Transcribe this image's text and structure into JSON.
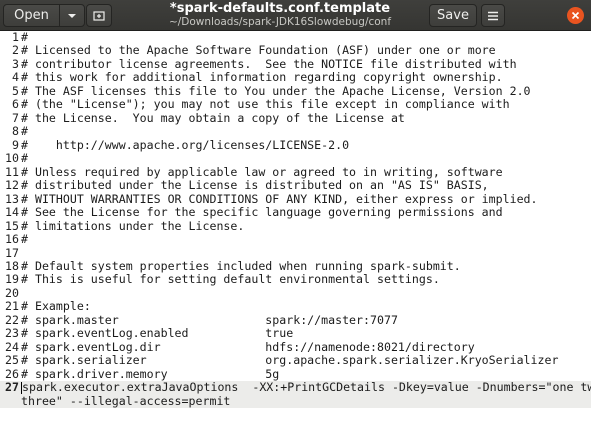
{
  "header": {
    "open_label": "Open",
    "save_label": "Save",
    "title": "*spark-defaults.conf.template",
    "subtitle": "~/Downloads/spark-JDK16Slowdebug/conf",
    "icons": [
      "chevron-down-icon",
      "new-tab-icon",
      "hamburger-menu-icon",
      "close-icon"
    ]
  },
  "editor": {
    "lines": [
      {
        "n": "1",
        "text": "#"
      },
      {
        "n": "2",
        "text": "# Licensed to the Apache Software Foundation (ASF) under one or more"
      },
      {
        "n": "3",
        "text": "# contributor license agreements.  See the NOTICE file distributed with"
      },
      {
        "n": "4",
        "text": "# this work for additional information regarding copyright ownership."
      },
      {
        "n": "5",
        "text": "# The ASF licenses this file to You under the Apache License, Version 2.0"
      },
      {
        "n": "6",
        "text": "# (the \"License\"); you may not use this file except in compliance with"
      },
      {
        "n": "7",
        "text": "# the License.  You may obtain a copy of the License at"
      },
      {
        "n": "8",
        "text": "#"
      },
      {
        "n": "9",
        "text": "#    http://www.apache.org/licenses/LICENSE-2.0"
      },
      {
        "n": "10",
        "text": "#"
      },
      {
        "n": "11",
        "text": "# Unless required by applicable law or agreed to in writing, software"
      },
      {
        "n": "12",
        "text": "# distributed under the License is distributed on an \"AS IS\" BASIS,"
      },
      {
        "n": "13",
        "text": "# WITHOUT WARRANTIES OR CONDITIONS OF ANY KIND, either express or implied."
      },
      {
        "n": "14",
        "text": "# See the License for the specific language governing permissions and"
      },
      {
        "n": "15",
        "text": "# limitations under the License."
      },
      {
        "n": "16",
        "text": "#"
      },
      {
        "n": "17",
        "text": ""
      },
      {
        "n": "18",
        "text": "# Default system properties included when running spark-submit."
      },
      {
        "n": "19",
        "text": "# This is useful for setting default environmental settings."
      },
      {
        "n": "20",
        "text": ""
      },
      {
        "n": "21",
        "text": "# Example:"
      },
      {
        "n": "22",
        "text": "# spark.master                     spark://master:7077"
      },
      {
        "n": "23",
        "text": "# spark.eventLog.enabled           true"
      },
      {
        "n": "24",
        "text": "# spark.eventLog.dir               hdfs://namenode:8021/directory"
      },
      {
        "n": "25",
        "text": "# spark.serializer                 org.apache.spark.serializer.KryoSerializer"
      },
      {
        "n": "26",
        "text": "# spark.driver.memory              5g"
      }
    ],
    "current_line": {
      "n": "27",
      "text": "spark.executor.extraJavaOptions  -XX:+PrintGCDetails -Dkey=value -Dnumbers=\"one two",
      "continuation": "three\" --illegal-access=permit"
    }
  }
}
